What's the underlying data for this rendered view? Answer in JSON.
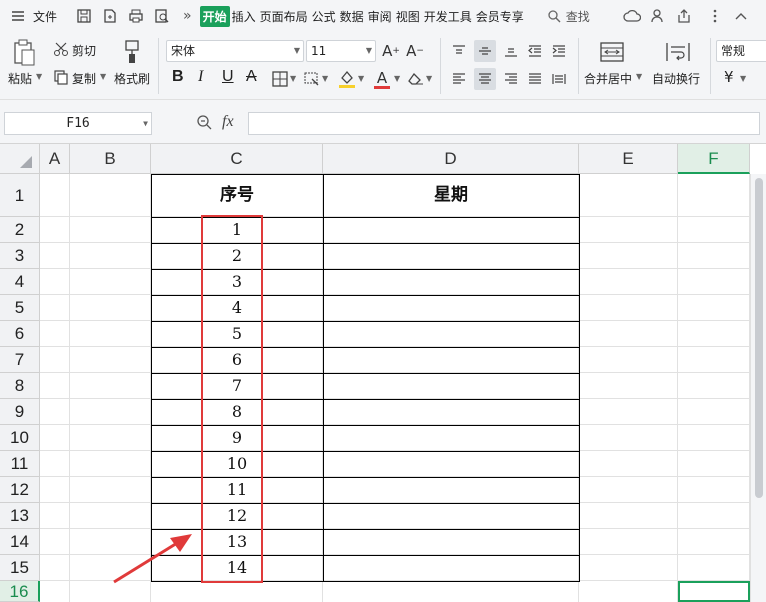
{
  "menubar": {
    "file_label": "文件",
    "more": "»",
    "tabs": [
      "开始",
      "插入",
      "页面布局",
      "公式",
      "数据",
      "审阅",
      "视图",
      "开发工具",
      "会员专享"
    ],
    "search_label": "查找"
  },
  "ribbon": {
    "paste": "粘贴",
    "cut": "剪切",
    "copy": "复制",
    "format_painter": "格式刷",
    "font_name": "宋体",
    "font_size": "11",
    "bold": "B",
    "italic": "I",
    "underline": "U",
    "strike": "A",
    "font_color": "A",
    "merge_center": "合并居中",
    "wrap_text": "自动换行",
    "number_format": "常规",
    "currency": "¥"
  },
  "formula_bar": {
    "name_box": "F16",
    "fx": "fx"
  },
  "grid": {
    "columns": [
      "A",
      "B",
      "C",
      "D",
      "E",
      "F"
    ],
    "selected_column": "F",
    "rows": [
      "1",
      "2",
      "3",
      "4",
      "5",
      "6",
      "7",
      "8",
      "9",
      "10",
      "11",
      "12",
      "13",
      "14",
      "15",
      "16"
    ],
    "selected_row": "16",
    "table": {
      "headers": [
        "序号",
        "星期"
      ],
      "serials": [
        "1",
        "2",
        "3",
        "4",
        "5",
        "6",
        "7",
        "8",
        "9",
        "10",
        "11",
        "12",
        "13",
        "14"
      ]
    }
  },
  "colors": {
    "accent": "#1aa05b",
    "highlight": "#e03a3a"
  }
}
